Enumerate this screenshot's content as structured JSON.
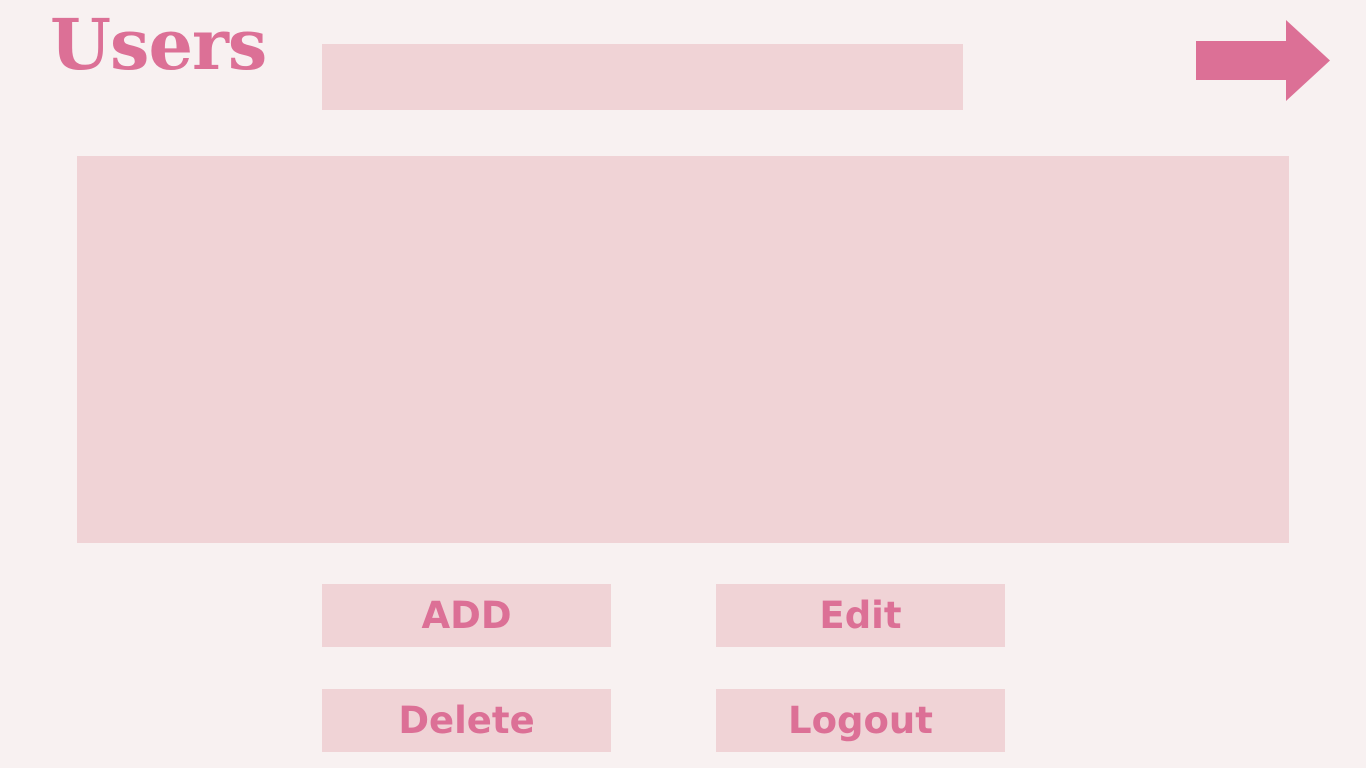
{
  "header": {
    "title": "Users",
    "search": {
      "value": "",
      "placeholder": ""
    },
    "next_icon": "right-arrow-icon"
  },
  "actions": {
    "add_label": "ADD",
    "edit_label": "Edit",
    "delete_label": "Delete",
    "logout_label": "Logout"
  },
  "colors": {
    "background": "#f8f1f1",
    "panel": "#f0d3d6",
    "accent": "#dc7096"
  }
}
